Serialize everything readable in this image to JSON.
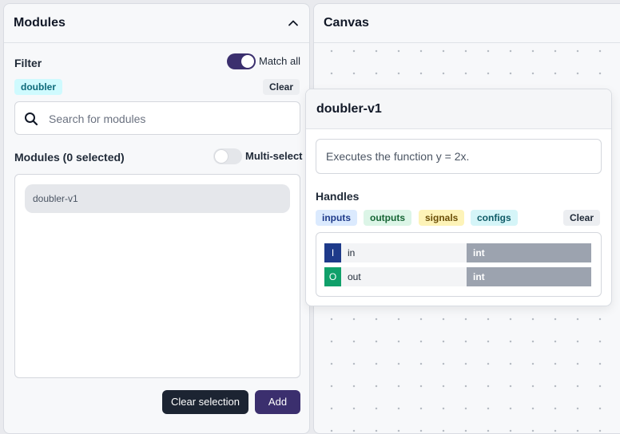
{
  "modules_panel": {
    "title": "Modules",
    "filter_label": "Filter",
    "match_all_label": "Match all",
    "match_all_on": true,
    "active_tag": "doubler",
    "clear_label": "Clear",
    "search_placeholder": "Search for modules",
    "list_title": "Modules (0 selected)",
    "multi_select_label": "Multi-select",
    "multi_select_on": false,
    "items": [
      {
        "label": "doubler-v1"
      }
    ],
    "clear_selection_label": "Clear selection",
    "add_label": "Add"
  },
  "canvas": {
    "title": "Canvas"
  },
  "popup": {
    "title": "doubler-v1",
    "description": "Executes the function y = 2x.",
    "handles_title": "Handles",
    "categories": [
      "inputs",
      "outputs",
      "signals",
      "configs"
    ],
    "clear_label": "Clear",
    "handles": [
      {
        "kind": "I",
        "name": "in",
        "type": "int"
      },
      {
        "kind": "O",
        "name": "out",
        "type": "int"
      }
    ]
  },
  "icons": [
    "chevron-up-icon",
    "search-icon"
  ],
  "colors": {
    "accent": "#3b2f6e",
    "input_badge": "#1e3a8a",
    "output_badge": "#10a06a"
  }
}
